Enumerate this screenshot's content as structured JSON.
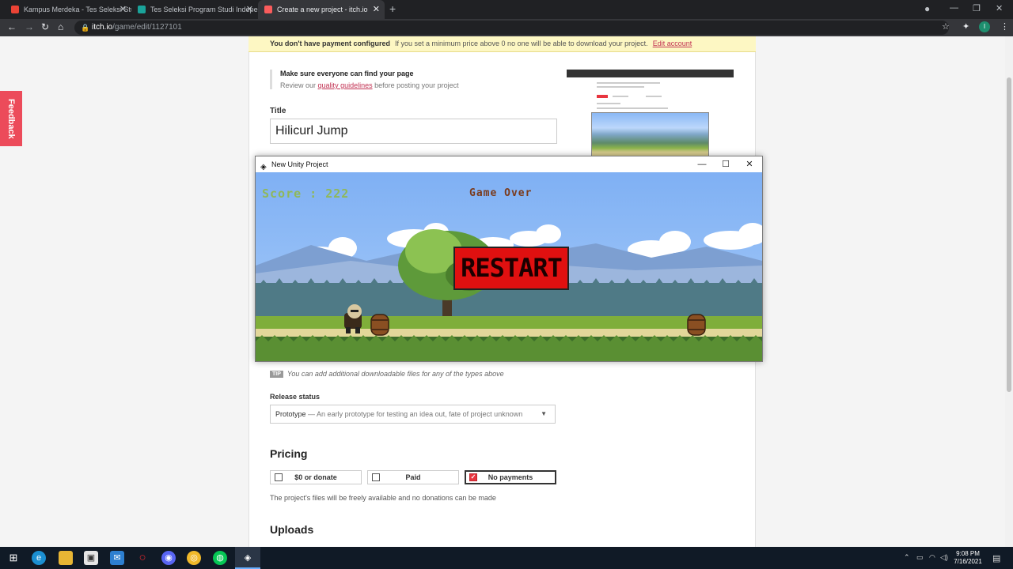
{
  "browser": {
    "tabs": [
      {
        "title": "Kampus Merdeka - Tes Seleksi Studi",
        "icon": "gmail-icon",
        "color": "#ea4335"
      },
      {
        "title": "Tes Seleksi Program Studi Indepen",
        "icon": "classroom-icon",
        "color": "#1aa39a"
      },
      {
        "title": "Create a new project - itch.io",
        "icon": "itchio-icon",
        "color": "#fa5c5c"
      }
    ],
    "url_host": "itch.io",
    "url_path": "/game/edit/1127101",
    "profile_initial": "I"
  },
  "banner": {
    "title": "You don't have payment configured",
    "text": "If you set a minimum price above 0 no one will be able to download your project.",
    "link": "Edit account"
  },
  "feedback_label": "Feedback",
  "tip_box": {
    "heading": "Make sure everyone can find your page",
    "prefix": "Review our",
    "link": "quality guidelines",
    "suffix": "before posting your project"
  },
  "title_label": "Title",
  "title_value": "Hilicurl Jump",
  "unity_window": {
    "title": "New Unity Project",
    "score_text": "Score : 222",
    "game_over_text": "Game Over",
    "restart_label": "RESTART"
  },
  "downloads_tip": {
    "tag": "TIP",
    "text": "You can add additional downloadable files for any of the types above"
  },
  "release_status": {
    "label": "Release status",
    "selected": "Prototype",
    "description": "— An early prototype for testing an idea out, fate of project unknown"
  },
  "pricing": {
    "heading": "Pricing",
    "options": [
      "$0 or donate",
      "Paid",
      "No payments"
    ],
    "selected": "No payments",
    "description": "The project's files will be freely available and no donations can be made"
  },
  "uploads_heading": "Uploads",
  "taskbar": {
    "time": "9:08 PM",
    "date": "7/16/2021"
  }
}
